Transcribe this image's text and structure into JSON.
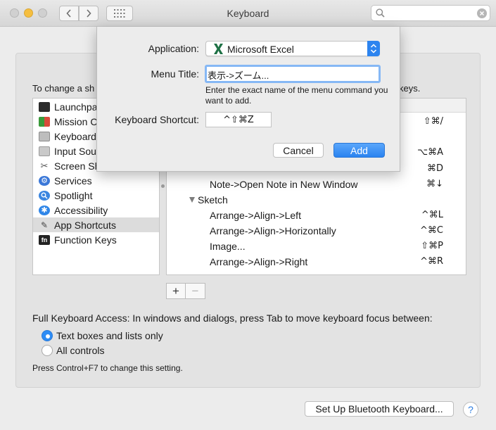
{
  "window": {
    "title": "Keyboard"
  },
  "colors": {
    "accent": "#2d84ef",
    "close": "#d0d0d0",
    "minimize": "#f5be3f",
    "zoom": "#d0d0d0",
    "excel_green": "#1e7145"
  },
  "toolbar": {
    "back_glyph": "〈",
    "forward_glyph": "〉",
    "search_placeholder": ""
  },
  "main": {
    "instruction_left": "To change a sh",
    "instruction_right": "keys."
  },
  "categories": [
    {
      "label": "Launchpa",
      "icon": "launchpad-icon"
    },
    {
      "label": "Mission C",
      "icon": "mission-control-icon"
    },
    {
      "label": "Keyboard",
      "icon": "keyboard-icon"
    },
    {
      "label": "Input Sou",
      "icon": "input-sources-icon"
    },
    {
      "label": "Screen Sh",
      "icon": "screenshot-icon"
    },
    {
      "label": "Services",
      "icon": "gear-icon"
    },
    {
      "label": "Spotlight",
      "icon": "spotlight-icon"
    },
    {
      "label": "Accessibility",
      "icon": "accessibility-icon"
    },
    {
      "label": "App Shortcuts",
      "icon": "app-shortcuts-icon",
      "selected": true
    },
    {
      "label": "Function Keys",
      "icon": "function-keys-icon"
    }
  ],
  "shortcuts": {
    "partial_rows": [
      {
        "keys": "⇧⌘/"
      },
      {
        "keys": "⌥⌘A"
      },
      {
        "keys": "⌘D"
      }
    ],
    "rows": [
      {
        "name": "Note->Open Note in New Window",
        "keys": "⌘↓"
      },
      {
        "name": "Sketch",
        "keys": "",
        "group": true
      },
      {
        "name": "Arrange->Align->Left",
        "keys": "^⌘L"
      },
      {
        "name": "Arrange->Align->Horizontally",
        "keys": "^⌘C"
      },
      {
        "name": "Image...",
        "keys": "⇧⌘P"
      },
      {
        "name": "Arrange->Align->Right",
        "keys": "^⌘R"
      }
    ],
    "add_label": "+",
    "remove_label": "−"
  },
  "full_keyboard_access": {
    "label": "Full Keyboard Access: In windows and dialogs, press Tab to move keyboard focus between:",
    "options": [
      {
        "label": "Text boxes and lists only",
        "selected": true
      },
      {
        "label": "All controls",
        "selected": false
      }
    ],
    "note": "Press Control+F7 to change this setting."
  },
  "footer": {
    "bluetooth_button": "Set Up Bluetooth Keyboard...",
    "help_button": "?"
  },
  "dialog": {
    "application_label": "Application:",
    "application_value": "Microsoft Excel",
    "menu_title_label": "Menu Title:",
    "menu_title_value": "表示->ズーム...",
    "help_text": "Enter the exact name of the menu command you want to add.",
    "shortcut_label": "Keyboard Shortcut:",
    "shortcut_value": "^⇧⌘Z",
    "cancel_label": "Cancel",
    "add_label": "Add"
  }
}
